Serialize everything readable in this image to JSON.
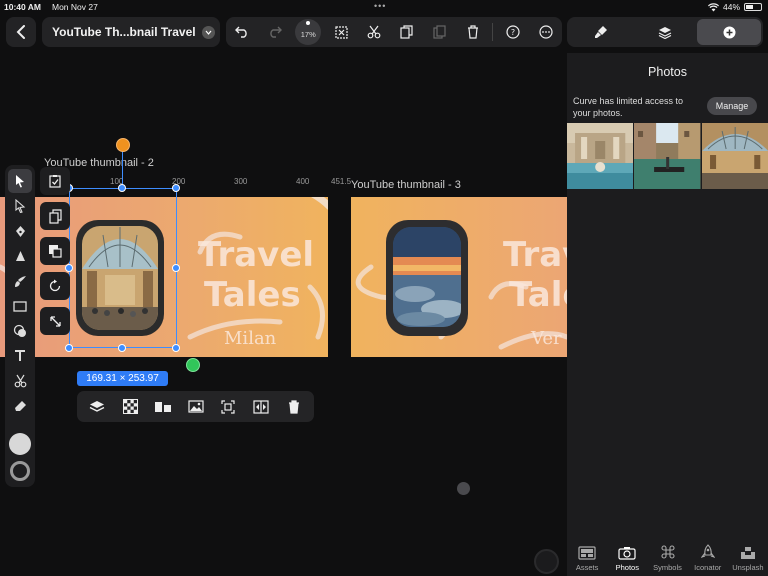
{
  "status_bar": {
    "time": "10:40 AM",
    "date": "Mon Nov 27",
    "battery": "44%",
    "battery_level": 0.44
  },
  "header": {
    "document_title": "YouTube Th...bnail Travel",
    "zoom_level": "17%"
  },
  "canvas": {
    "artboard_1": {
      "label": "YouTube thumbnail - 2",
      "title_line1": "Travel",
      "title_line2": "Tales",
      "subtitle": "Milan"
    },
    "artboard_2": {
      "label": "YouTube thumbnail - 3",
      "title_line1": "Trav",
      "title_line2": "Tale",
      "subtitle": "Ver"
    },
    "ruler_ticks": [
      "100",
      "200",
      "300",
      "400",
      "451.5"
    ],
    "selection_size": "169.31 × 253.97",
    "accent_color": "#3e8dff",
    "gradient_colors": [
      "#e89a7c",
      "#f0b35e"
    ]
  },
  "right_panel": {
    "title": "Photos",
    "access_message": "Curve has limited access to your photos.",
    "manage_label": "Manage",
    "bottom_tabs": [
      {
        "label": "Assets",
        "icon": "assets-icon"
      },
      {
        "label": "Photos",
        "icon": "camera-icon"
      },
      {
        "label": "Symbols",
        "icon": "command-icon"
      },
      {
        "label": "Iconator",
        "icon": "rocket-icon"
      },
      {
        "label": "Unsplash",
        "icon": "unsplash-icon"
      }
    ]
  }
}
